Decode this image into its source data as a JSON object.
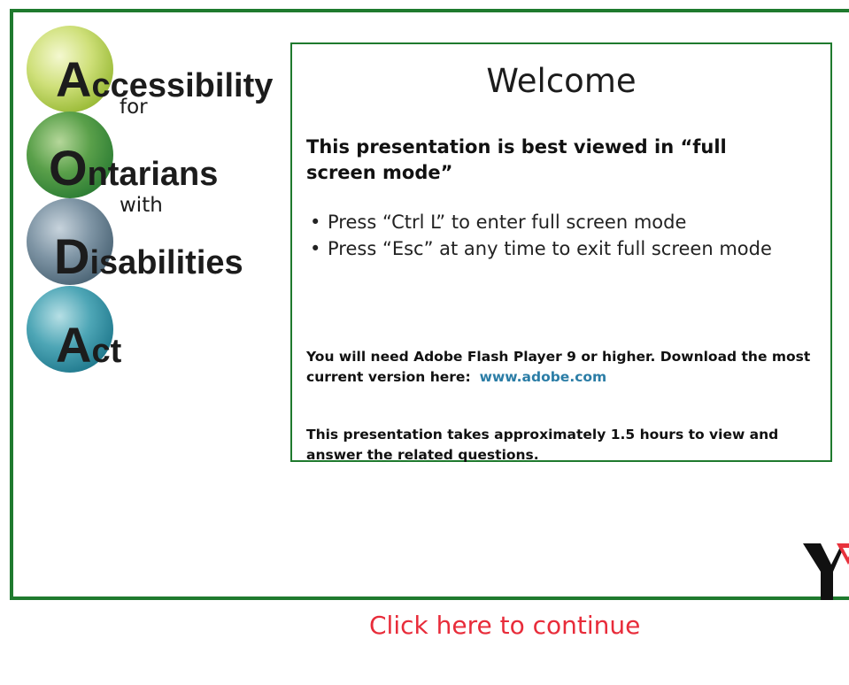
{
  "logo": {
    "line1_initial": "A",
    "line1_rest": "ccessibility",
    "connector1": "for",
    "line2_initial": "O",
    "line2_rest": "ntarians",
    "connector2": "with",
    "line3_initial": "D",
    "line3_rest": "isabilities",
    "line4_initial": "A",
    "line4_rest": "ct",
    "circle_colors": [
      "#c3d867",
      "#3e8b3f",
      "#5a7384",
      "#2b8295"
    ]
  },
  "panel": {
    "title": "Welcome",
    "heading": "This presentation is best viewed in “full screen mode”",
    "bullets": [
      "Press “Ctrl L” to enter  full screen mode",
      "Press “Esc” at any time to exit full screen mode"
    ],
    "flash_note": "You will need Adobe Flash Player 9 or higher.  Download the most current version here:",
    "flash_link": "www.adobe.com",
    "duration_note": "This presentation takes approximately 1.5 hours to view and answer the related questions."
  },
  "continue_link": "Click here to continue",
  "colors": {
    "frame_green": "#1f7a2e",
    "continue_red": "#e82c3a",
    "link_blue": "#2b7da6",
    "ymca_red": "#e8323c"
  },
  "icons": [
    "ymca-logo"
  ]
}
